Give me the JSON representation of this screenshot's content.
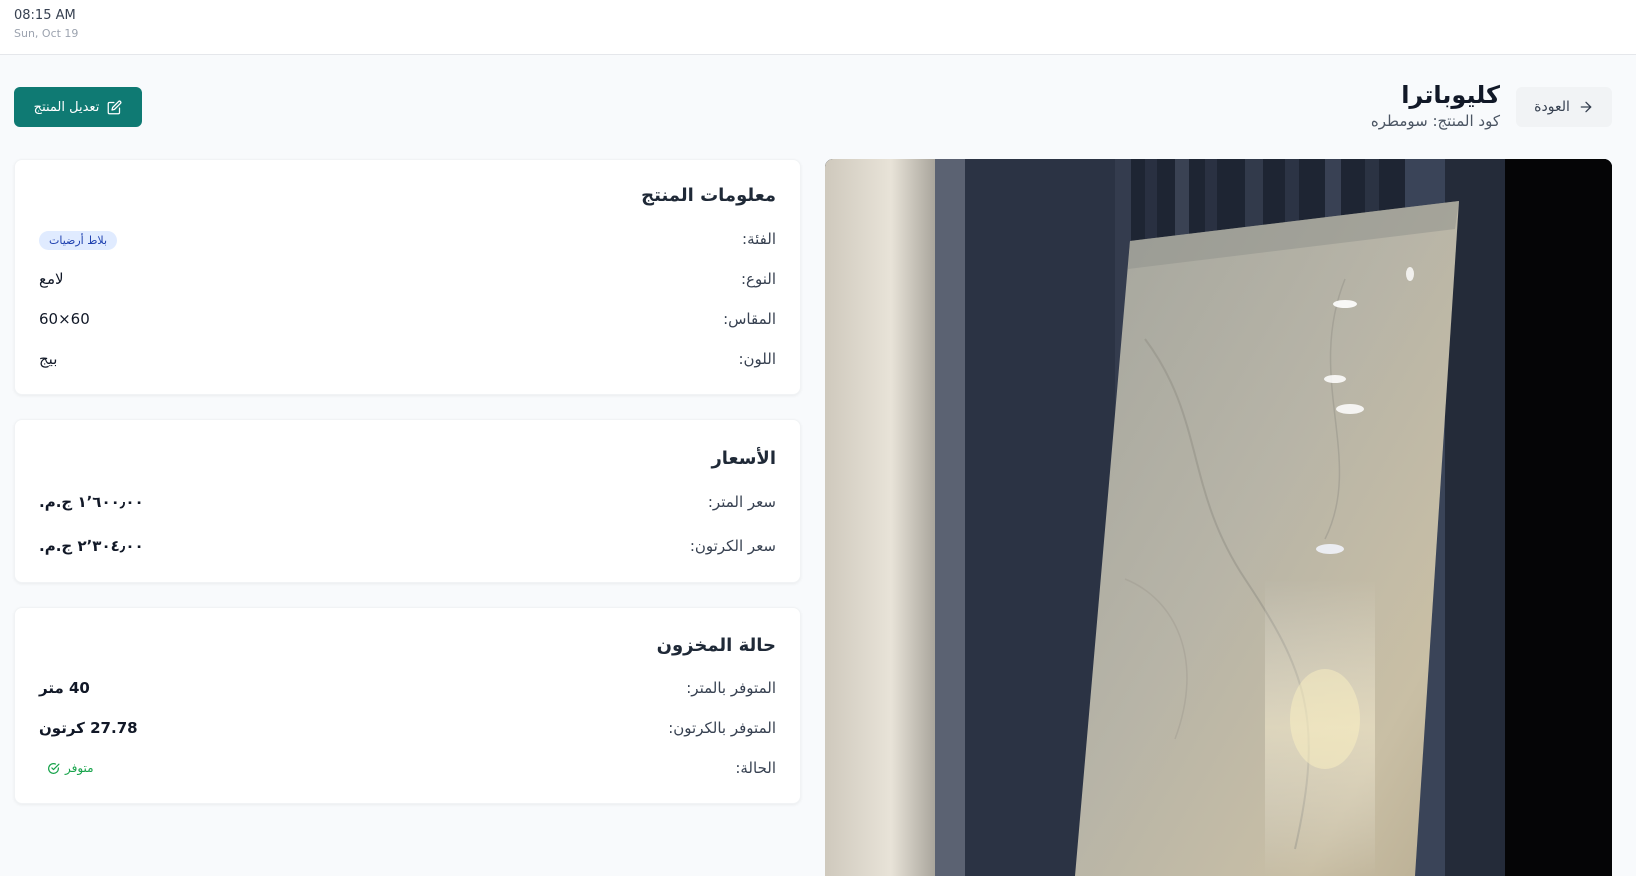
{
  "status_bar": {
    "time": "08:15 AM",
    "date": "Sun, Oct 19"
  },
  "header": {
    "title": "كليوباترا",
    "code_label": "كود المنتج: سومطره",
    "back_label": "العودة",
    "edit_label": "تعديل المنتج"
  },
  "info_card": {
    "title": "معلومات المنتج",
    "rows": [
      {
        "label": "الفئة:",
        "value": "بلاط أرضيات"
      },
      {
        "label": "النوع:",
        "value": "لامع"
      },
      {
        "label": "المقاس:",
        "value": "60×60"
      },
      {
        "label": "اللون:",
        "value": "بيج"
      }
    ]
  },
  "prices_card": {
    "title": "الأسعار",
    "rows": [
      {
        "label": "سعر المتر:",
        "value": "١٬٦٠٠٫٠٠ ج.م."
      },
      {
        "label": "سعر الكرتون:",
        "value": "٢٬٣٠٤٫٠٠ ج.م."
      }
    ]
  },
  "stock_card": {
    "title": "حالة المخزون",
    "rows": [
      {
        "label": "المتوفر بالمتر:",
        "value": "40 متر"
      },
      {
        "label": "المتوفر بالكرتون:",
        "value": "27.78 كرتون"
      },
      {
        "label": "الحالة:",
        "value": "متوفر"
      }
    ]
  },
  "icons": {
    "back": "arrow-right-icon",
    "edit": "edit-icon",
    "status": "check-circle-icon"
  },
  "colors": {
    "primary": "#0f7a73",
    "badge_bg": "#e0ebff",
    "badge_text": "#1e40af",
    "status_green": "#16a34a"
  }
}
